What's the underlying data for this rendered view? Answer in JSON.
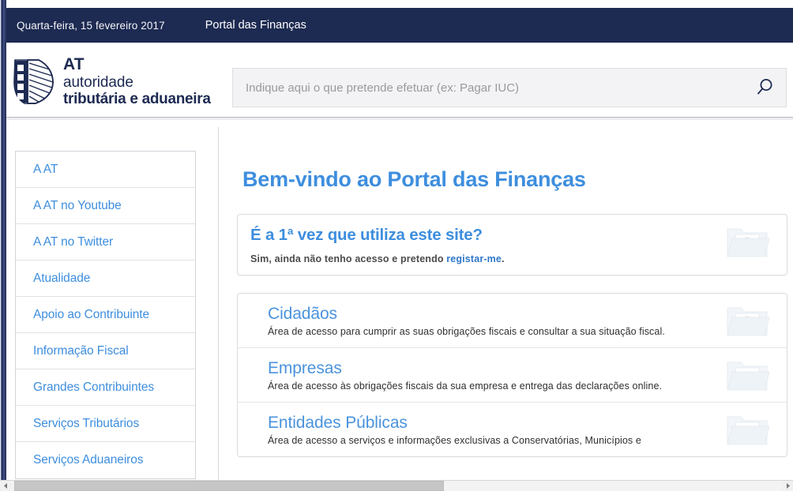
{
  "topbar": {
    "date": "Quarta-feira, 15 fevereiro 2017",
    "portal_title": "Portal das Finanças"
  },
  "logo": {
    "line1": "AT",
    "line2": "autoridade",
    "line3": "tributária e aduaneira",
    "mark_name": "at-shield-logo"
  },
  "search": {
    "placeholder": "Indique aqui o que pretende efetuar (ex: Pagar IUC)",
    "value": "",
    "icon": "search-icon"
  },
  "sidebar": {
    "items": [
      {
        "label": "A AT"
      },
      {
        "label": "A AT no Youtube"
      },
      {
        "label": "A AT no Twitter"
      },
      {
        "label": "Atualidade"
      },
      {
        "label": "Apoio ao Contribuinte"
      },
      {
        "label": "Informação Fiscal"
      },
      {
        "label": "Grandes Contribuintes"
      },
      {
        "label": "Serviços Tributários"
      },
      {
        "label": "Serviços Aduaneiros"
      }
    ]
  },
  "main": {
    "page_title": "Bem-vindo ao Portal das Finanças",
    "first_visit": {
      "heading": "É a 1ª vez que utiliza este site?",
      "text_before": "Sim, ainda não tenho acesso e pretendo ",
      "link": "registar-me",
      "text_after": ".",
      "icon": "folder-person-icon"
    },
    "services": [
      {
        "title": "Cidadãos",
        "description": "Área de acesso para cumprir as suas obrigações fiscais e consultar a sua situação fiscal.",
        "icon": "folder-person-icon"
      },
      {
        "title": "Empresas",
        "description": "Área de acesso às obrigações fiscais da sua empresa e entrega das declarações online.",
        "icon": "folder-factory-icon"
      },
      {
        "title": "Entidades Públicas",
        "description": "Área de acesso a serviços e informações exclusivas a Conservatórias, Municípios e",
        "icon": "folder-institution-icon"
      }
    ]
  },
  "scrollbar": {
    "left_arrow": "◄",
    "right_arrow": "►"
  },
  "colors": {
    "topbar_bg": "#1d2a52",
    "link_blue": "#3e8ede",
    "heading_blue": "#3e8ede",
    "search_bg": "#f3f3f5"
  }
}
